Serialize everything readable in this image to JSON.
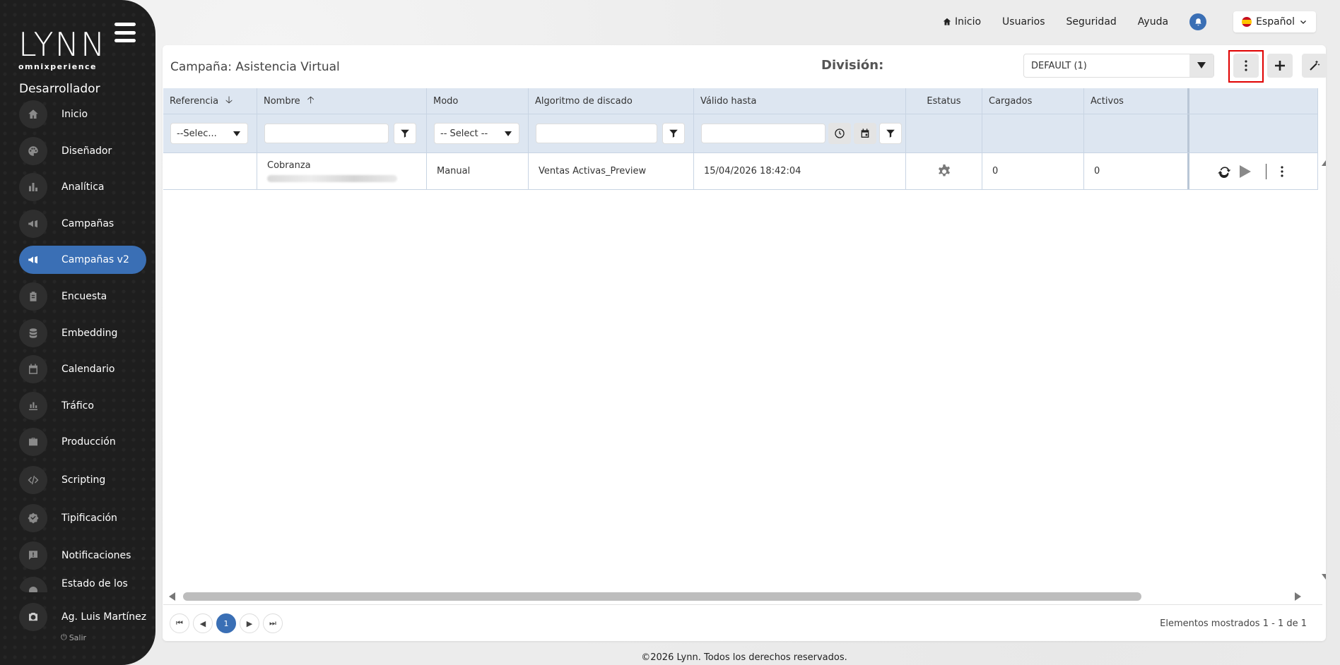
{
  "app": {
    "logo_text": "LYNN",
    "logo_sub": "omnixperience",
    "role": "Desarrollador"
  },
  "sidebar": {
    "items": [
      {
        "label": "Inicio",
        "icon": "home-icon"
      },
      {
        "label": "Diseñador",
        "icon": "palette-icon"
      },
      {
        "label": "Analítica",
        "icon": "bar-chart-icon"
      },
      {
        "label": "Campañas",
        "icon": "megaphone-icon"
      },
      {
        "label": "Campañas v2",
        "icon": "megaphone-icon"
      },
      {
        "label": "Encuesta",
        "icon": "clipboard-icon"
      },
      {
        "label": "Embedding",
        "icon": "database-icon"
      },
      {
        "label": "Calendario",
        "icon": "calendar-icon"
      },
      {
        "label": "Tráfico",
        "icon": "traffic-chart-icon"
      },
      {
        "label": "Producción",
        "icon": "briefcase-icon"
      },
      {
        "label": "Scripting",
        "icon": "code-icon"
      },
      {
        "label": "Tipificación",
        "icon": "badge-check-icon"
      },
      {
        "label": "Notificaciones",
        "icon": "message-alert-icon"
      },
      {
        "label": "Estado de los",
        "icon": "status-icon"
      }
    ],
    "active_index": 4,
    "user_name": "Ag. Luis Martínez",
    "logout_label": "Salir"
  },
  "topnav": {
    "home": "Inicio",
    "users": "Usuarios",
    "security": "Seguridad",
    "help": "Ayuda",
    "language": "Español"
  },
  "panel": {
    "title": "Campaña: Asistencia Virtual",
    "division_label": "División:",
    "division_value": "DEFAULT (1)"
  },
  "grid": {
    "columns": [
      "Referencia",
      "Nombre",
      "Modo",
      "Algoritmo de discado",
      "Válido hasta",
      "Estatus",
      "Cargados",
      "Activos"
    ],
    "filters": {
      "referencia_select": "--Selec...",
      "modo_select": "-- Select --"
    },
    "rows": [
      {
        "referencia": "",
        "nombre": "Cobranza",
        "modo": "Manual",
        "algoritmo": "Ventas Activas_Preview",
        "valido_hasta": "15/04/2026 18:42:04",
        "cargados": "0",
        "activos": "0"
      }
    ]
  },
  "pager": {
    "current_page": "1",
    "info": "Elementos mostrados 1 - 1 de 1"
  },
  "footer": "©2026 Lynn. Todos los derechos reservados.",
  "colors": {
    "accent": "#3a6fb5",
    "sidebar_bg": "#1e1e1e",
    "header_bg": "#dde6f1",
    "highlight": "#e00000"
  }
}
